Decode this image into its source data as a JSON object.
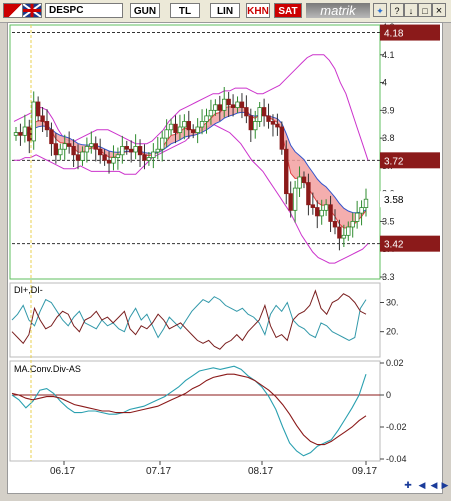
{
  "toolbar": {
    "symbol": "DESPC",
    "period_buttons": [
      "GUN",
      "TL",
      "LIN"
    ],
    "khn_label": "KHN",
    "sat_label": "SAT",
    "logo_text": "matrik",
    "help_label": "?",
    "close_label": "×"
  },
  "colors": {
    "candle_up": "#2e8b2e",
    "candle_down": "#8b1a1a",
    "bollinger": "#cc33cc",
    "ema_ribbon": "#e04040",
    "ema_blue": "#3355cc",
    "price_tag_bg": "#8b1a1a",
    "di_plus": "#3399aa",
    "di_minus": "#7a1f1f",
    "macd": "#2aa0b0",
    "signal": "#8b1a1a",
    "zero_line": "#8b1a1a"
  },
  "chart_data": [
    {
      "type": "candlestick",
      "panel": "price",
      "x_ticks": [
        "06.17",
        "07.17",
        "08.17",
        "09.17"
      ],
      "y_ticks": [
        4.2,
        4.1,
        4.0,
        3.9,
        3.8,
        3.7,
        3.6,
        3.5,
        3.4,
        3.3
      ],
      "y_tick_labels": [
        "4.2",
        "4.1",
        "4",
        "3.9",
        "3.8",
        "3.7",
        "3.6",
        "3.5",
        "3.4",
        "3.3"
      ],
      "ylim": [
        3.3,
        4.2
      ],
      "price_tags": [
        "4.18",
        "3.72",
        "3.58",
        "3.42"
      ],
      "reference_lines": [
        4.18,
        3.72,
        3.42
      ],
      "closes": [
        3.82,
        3.81,
        3.84,
        3.79,
        3.93,
        3.88,
        3.86,
        3.83,
        3.78,
        3.74,
        3.76,
        3.78,
        3.77,
        3.74,
        3.72,
        3.75,
        3.77,
        3.78,
        3.76,
        3.74,
        3.72,
        3.71,
        3.73,
        3.74,
        3.77,
        3.76,
        3.75,
        3.77,
        3.74,
        3.72,
        3.73,
        3.75,
        3.76,
        3.8,
        3.83,
        3.85,
        3.82,
        3.84,
        3.86,
        3.83,
        3.82,
        3.84,
        3.86,
        3.88,
        3.9,
        3.92,
        3.9,
        3.94,
        3.92,
        3.91,
        3.93,
        3.91,
        3.88,
        3.83,
        3.86,
        3.91,
        3.88,
        3.86,
        3.85,
        3.84,
        3.76,
        3.6,
        3.54,
        3.62,
        3.66,
        3.64,
        3.56,
        3.55,
        3.52,
        3.54,
        3.56,
        3.5,
        3.48,
        3.44,
        3.45,
        3.48,
        3.5,
        3.53,
        3.55,
        3.58
      ],
      "bollinger_upper": [
        3.86,
        3.87,
        3.88,
        3.89,
        3.91,
        3.91,
        3.9,
        3.87,
        3.83,
        3.8,
        3.79,
        3.79,
        3.8,
        3.81,
        3.82,
        3.83,
        3.83,
        3.83,
        3.82,
        3.81,
        3.8,
        3.79,
        3.78,
        3.78,
        3.78,
        3.79,
        3.81,
        3.83,
        3.86,
        3.88,
        3.9,
        3.91,
        3.92,
        3.93,
        3.94,
        3.95,
        3.96,
        3.96,
        3.97,
        3.97,
        3.98,
        3.98,
        3.98,
        3.97,
        3.96,
        3.96,
        3.97,
        3.98,
        3.99,
        4.01,
        4.03,
        4.05,
        4.07,
        4.09,
        4.1,
        4.1,
        4.1,
        4.08,
        4.05,
        4.0,
        3.96,
        3.9,
        3.84,
        3.78,
        3.72
      ],
      "bollinger_lower": [
        3.72,
        3.72,
        3.73,
        3.73,
        3.74,
        3.73,
        3.72,
        3.71,
        3.7,
        3.69,
        3.69,
        3.69,
        3.7,
        3.69,
        3.68,
        3.68,
        3.68,
        3.68,
        3.68,
        3.68,
        3.67,
        3.67,
        3.67,
        3.69,
        3.71,
        3.73,
        3.74,
        3.75,
        3.76,
        3.77,
        3.78,
        3.79,
        3.81,
        3.82,
        3.83,
        3.84,
        3.85,
        3.84,
        3.83,
        3.82,
        3.8,
        3.78,
        3.75,
        3.72,
        3.7,
        3.68,
        3.65,
        3.62,
        3.59,
        3.56,
        3.53,
        3.49,
        3.45,
        3.42,
        3.39,
        3.37,
        3.36,
        3.35,
        3.35,
        3.36,
        3.37,
        3.38,
        3.39,
        3.4,
        3.42
      ]
    },
    {
      "type": "line",
      "panel": "indicator",
      "title": "DI+,DI-",
      "y_ticks": [
        30,
        20
      ],
      "y_tick_labels": [
        "30.",
        "20."
      ],
      "ylim": [
        12,
        36
      ],
      "series": [
        {
          "values": [
            24,
            26,
            29,
            24,
            22,
            27,
            31,
            30,
            27,
            24,
            22,
            25,
            27,
            23,
            22,
            21,
            24,
            22,
            23,
            21,
            20,
            25,
            28,
            24,
            26,
            22,
            18,
            21,
            25,
            23,
            21,
            24,
            27,
            29,
            31,
            30,
            32,
            31,
            29,
            28,
            27,
            28,
            26,
            25,
            23,
            19,
            26,
            29,
            27,
            30,
            24,
            22,
            21,
            19,
            18,
            23,
            22,
            20,
            19,
            18,
            17,
            18,
            28,
            31
          ]
        },
        {
          "values": [
            20,
            18,
            16,
            19,
            28,
            24,
            21,
            22,
            25,
            27,
            26,
            22,
            20,
            24,
            25,
            27,
            24,
            25,
            23,
            25,
            27,
            21,
            19,
            22,
            21,
            23,
            26,
            24,
            21,
            22,
            23,
            21,
            19,
            17,
            16,
            17,
            15,
            14,
            16,
            17,
            19,
            17,
            20,
            22,
            24,
            29,
            22,
            18,
            19,
            17,
            24,
            26,
            27,
            29,
            34,
            28,
            26,
            30,
            31,
            33,
            32,
            30,
            27,
            26
          ]
        }
      ]
    },
    {
      "type": "line",
      "panel": "indicator",
      "title": "MA.Conv.Div-AS",
      "y_ticks": [
        0.02,
        0,
        -0.02,
        -0.04
      ],
      "y_tick_labels": [
        "0.02",
        "0",
        "-0.02",
        "-0.04"
      ],
      "ylim": [
        -0.04,
        0.02
      ],
      "series": [
        {
          "values": [
            0.0,
            -0.003,
            -0.008,
            -0.004,
            0.003,
            0.004,
            0.001,
            -0.004,
            -0.008,
            -0.011,
            -0.011,
            -0.01,
            -0.01,
            -0.011,
            -0.012,
            -0.012,
            -0.011,
            -0.009,
            -0.008,
            -0.007,
            -0.005,
            -0.003,
            -0.001,
            0.002,
            0.005,
            0.009,
            0.012,
            0.015,
            0.016,
            0.017,
            0.016,
            0.017,
            0.018,
            0.016,
            0.012,
            0.009,
            0.005,
            -0.001,
            -0.009,
            -0.02,
            -0.03,
            -0.035,
            -0.038,
            -0.036,
            -0.032,
            -0.03,
            -0.028,
            -0.022,
            -0.015,
            -0.008,
            0.0,
            0.013
          ]
        },
        {
          "values": [
            0.001,
            0.0,
            -0.002,
            -0.003,
            -0.002,
            -0.001,
            -0.001,
            -0.002,
            -0.004,
            -0.006,
            -0.007,
            -0.008,
            -0.009,
            -0.01,
            -0.01,
            -0.011,
            -0.011,
            -0.011,
            -0.01,
            -0.009,
            -0.008,
            -0.007,
            -0.005,
            -0.003,
            -0.001,
            0.001,
            0.004,
            0.006,
            0.009,
            0.011,
            0.012,
            0.013,
            0.013,
            0.012,
            0.011,
            0.009,
            0.006,
            0.003,
            -0.001,
            -0.006,
            -0.012,
            -0.019,
            -0.025,
            -0.029,
            -0.031,
            -0.031,
            -0.029,
            -0.026,
            -0.023,
            -0.02,
            -0.016,
            -0.013
          ]
        }
      ]
    }
  ]
}
